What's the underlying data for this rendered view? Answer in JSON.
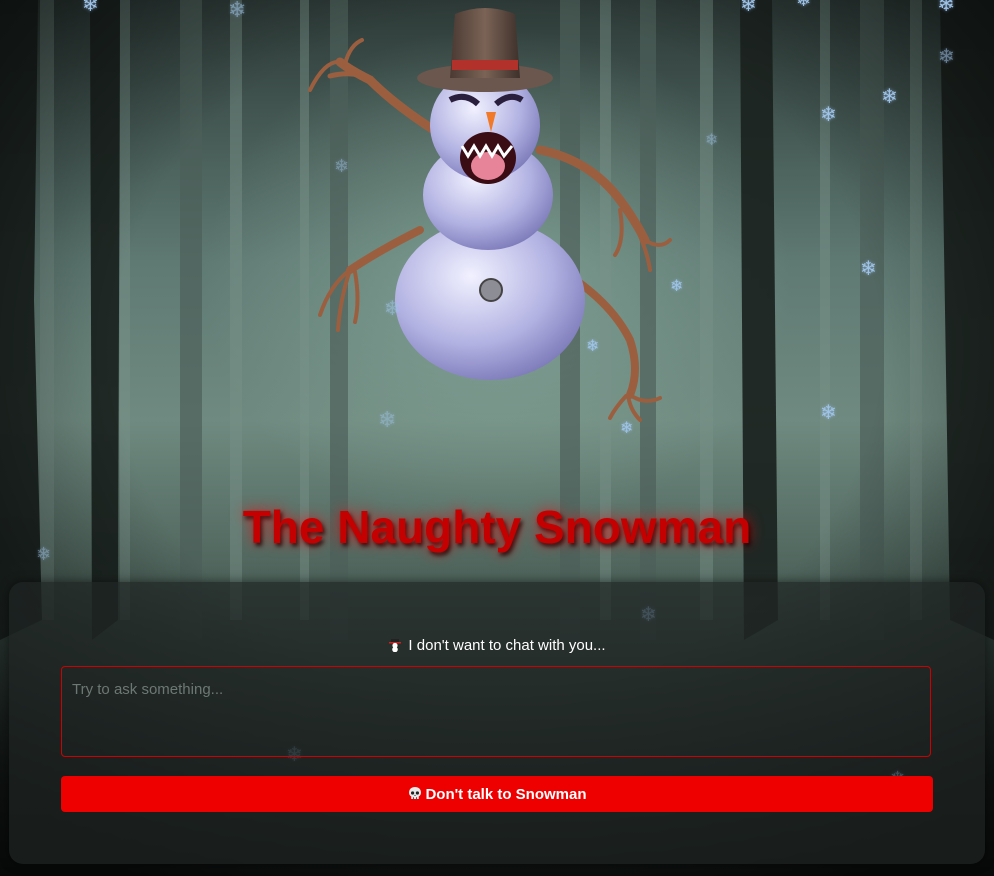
{
  "title": "The Naughty Snowman",
  "chat": {
    "reply_icon": "snowman-icon",
    "reply_text": "I don't want to chat with you...",
    "input_placeholder": "Try to ask something...",
    "input_value": "",
    "button_icon": "skull-icon",
    "button_label": "Don't talk to Snowman"
  },
  "colors": {
    "title": "#c40000",
    "button": "#ee0000",
    "input_border": "#d10000",
    "snowflake": "#9fc3e6",
    "panel": "#1e2422"
  },
  "decorations": {
    "snowflake_glyph": "❄",
    "background": "foggy-dark-forest",
    "hero_image": "monstrous-snowman-with-top-hat"
  }
}
